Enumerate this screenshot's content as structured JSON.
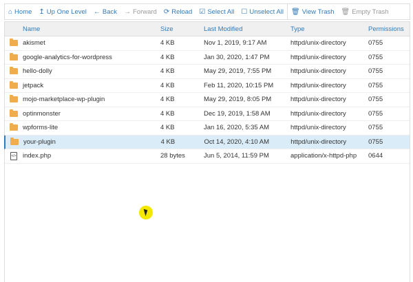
{
  "toolbar": [
    {
      "label": "Home",
      "icon": "home-icon",
      "glyph": "⌂",
      "disabled": false
    },
    {
      "label": "Up One Level",
      "icon": "level-up-icon",
      "glyph": "↥",
      "disabled": false
    },
    {
      "label": "Back",
      "icon": "arrow-left-icon",
      "glyph": "←",
      "disabled": false
    },
    {
      "label": "Forward",
      "icon": "arrow-right-icon",
      "glyph": "→",
      "disabled": true
    },
    {
      "label": "Reload",
      "icon": "reload-icon",
      "glyph": "⟳",
      "disabled": false
    },
    {
      "label": "Select All",
      "icon": "checkbox-checked-icon",
      "glyph": "☑",
      "disabled": false
    },
    {
      "label": "Unselect All",
      "icon": "checkbox-empty-icon",
      "glyph": "☐",
      "disabled": false
    },
    {
      "label": "View Trash",
      "icon": "trash-icon",
      "glyph": "🗑",
      "disabled": false
    },
    {
      "label": "Empty Trash",
      "icon": "trash-icon",
      "glyph": "🗑",
      "disabled": true
    }
  ],
  "columns": [
    "Name",
    "Size",
    "Last Modified",
    "Type",
    "Permissions"
  ],
  "rows": [
    {
      "name": "akismet",
      "size": "4 KB",
      "modified": "Nov 1, 2019, 9:17 AM",
      "type": "httpd/unix-directory",
      "perms": "0755",
      "kind": "folder"
    },
    {
      "name": "google-analytics-for-wordpress",
      "size": "4 KB",
      "modified": "Jan 30, 2020, 1:47 PM",
      "type": "httpd/unix-directory",
      "perms": "0755",
      "kind": "folder"
    },
    {
      "name": "hello-dolly",
      "size": "4 KB",
      "modified": "May 29, 2019, 7:55 PM",
      "type": "httpd/unix-directory",
      "perms": "0755",
      "kind": "folder"
    },
    {
      "name": "jetpack",
      "size": "4 KB",
      "modified": "Feb 11, 2020, 10:15 PM",
      "type": "httpd/unix-directory",
      "perms": "0755",
      "kind": "folder"
    },
    {
      "name": "mojo-marketplace-wp-plugin",
      "size": "4 KB",
      "modified": "May 29, 2019, 8:05 PM",
      "type": "httpd/unix-directory",
      "perms": "0755",
      "kind": "folder"
    },
    {
      "name": "optinmonster",
      "size": "4 KB",
      "modified": "Dec 19, 2019, 1:58 AM",
      "type": "httpd/unix-directory",
      "perms": "0755",
      "kind": "folder"
    },
    {
      "name": "wpforms-lite",
      "size": "4 KB",
      "modified": "Jan 16, 2020, 5:35 AM",
      "type": "httpd/unix-directory",
      "perms": "0755",
      "kind": "folder"
    },
    {
      "name": "your-plugin",
      "size": "4 KB",
      "modified": "Oct 14, 2020, 4:10 AM",
      "type": "httpd/unix-directory",
      "perms": "0755",
      "kind": "folder",
      "selected": true
    },
    {
      "name": "index.php",
      "size": "28 bytes",
      "modified": "Jun 5, 2014, 11:59 PM",
      "type": "application/x-httpd-php",
      "perms": "0644",
      "kind": "file"
    }
  ]
}
